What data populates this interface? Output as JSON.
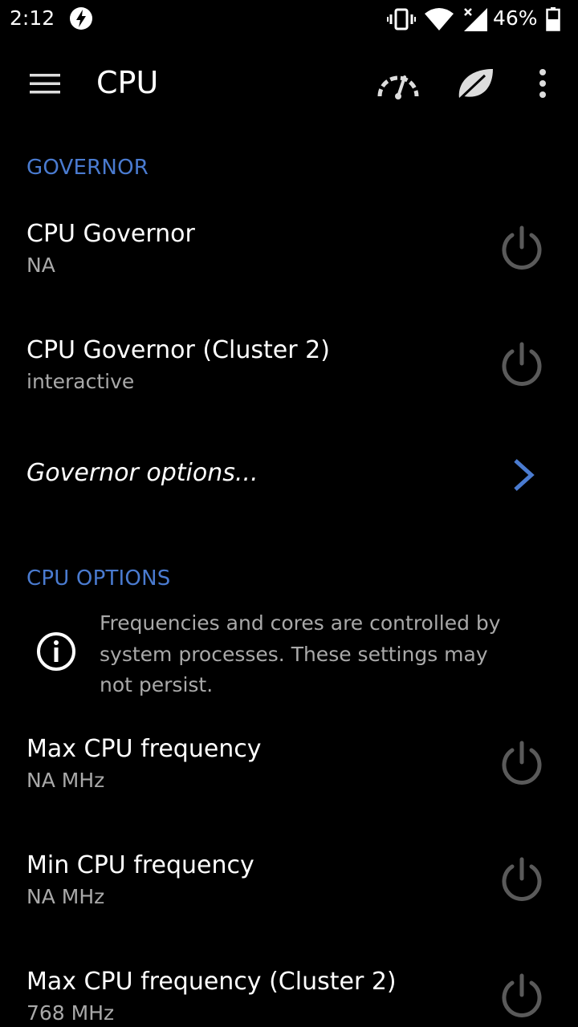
{
  "status_bar": {
    "time": "2:12",
    "battery_percent": "46%",
    "icons": [
      "flash-icon",
      "vibrate-icon",
      "wifi-icon",
      "cell-signal-icon",
      "battery-icon"
    ]
  },
  "toolbar": {
    "title": "CPU",
    "icons": [
      "menu-icon",
      "gauge-icon",
      "leaf-icon",
      "more-vert-icon"
    ]
  },
  "governor_section": {
    "header": "GOVERNOR",
    "items": [
      {
        "title": "CPU Governor",
        "value": "NA"
      },
      {
        "title": "CPU Governor (Cluster 2)",
        "value": "interactive"
      }
    ],
    "options_label": "Governor options..."
  },
  "cpu_options_section": {
    "header": "CPU OPTIONS",
    "info_text": "Frequencies and cores are controlled by system processes. These settings may not persist.",
    "items": [
      {
        "title": "Max CPU frequency",
        "value": "NA MHz"
      },
      {
        "title": "Min CPU frequency",
        "value": "NA MHz"
      },
      {
        "title": "Max CPU frequency (Cluster 2)",
        "value": "768 MHz"
      }
    ]
  },
  "colors": {
    "accent": "#4a7bd0",
    "background": "#000000",
    "secondary_text": "#a9a9a9",
    "icon_gray": "#5a5a5a"
  }
}
